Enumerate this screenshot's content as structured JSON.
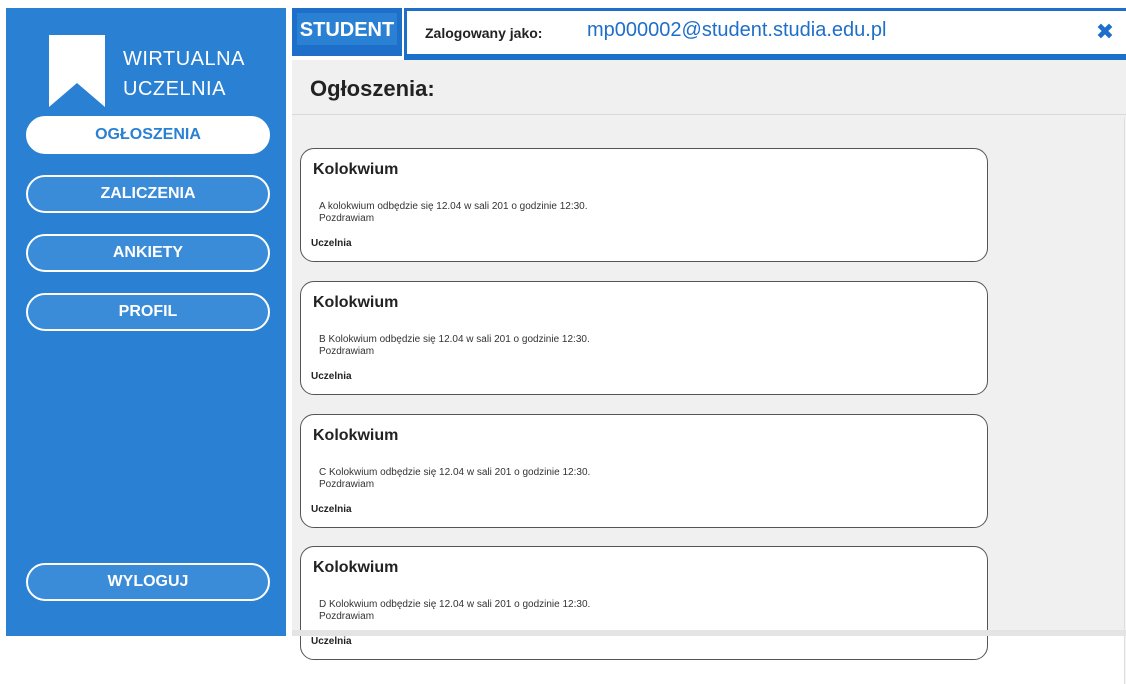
{
  "app": {
    "logo_icon": "bookmark-icon",
    "logo_line1": "WIRTUALNA",
    "logo_line2": "UCZELNIA"
  },
  "sidebar": {
    "items": [
      {
        "label": "OGŁOSZENIA",
        "active": true
      },
      {
        "label": "ZALICZENIA",
        "active": false
      },
      {
        "label": "ANKIETY",
        "active": false
      },
      {
        "label": "PROFIL",
        "active": false
      }
    ],
    "logout_label": "WYLOGUJ"
  },
  "header": {
    "role": "STUDENT",
    "logged_in_label": "Zalogowany jako:",
    "email": "mp000002@student.studia.edu.pl",
    "close_icon": "close-icon"
  },
  "main": {
    "title": "Ogłoszenia:",
    "announcements": [
      {
        "title": "Kolokwium",
        "body": "A kolokwium odbędzie się 12.04 w sali 201 o godzinie 12:30.\nPozdrawiam",
        "author": "Uczelnia"
      },
      {
        "title": "Kolokwium",
        "body": "B Kolokwium odbędzie się 12.04 w sali 201 o godzinie 12:30.\nPozdrawiam",
        "author": "Uczelnia"
      },
      {
        "title": "Kolokwium",
        "body": "C Kolokwium odbędzie się 12.04 w sali 201 o godzinie 12:30.\nPozdrawiam",
        "author": "Uczelnia"
      },
      {
        "title": "Kolokwium",
        "body": "D Kolokwium odbędzie się 12.04 w sali 201 o godzinie 12:30.\nPozdrawiam",
        "author": "Uczelnia"
      }
    ]
  },
  "colors": {
    "accent": "#2a80d3",
    "accent_dark": "#1e6fc9",
    "background": "#f0f0f0"
  }
}
